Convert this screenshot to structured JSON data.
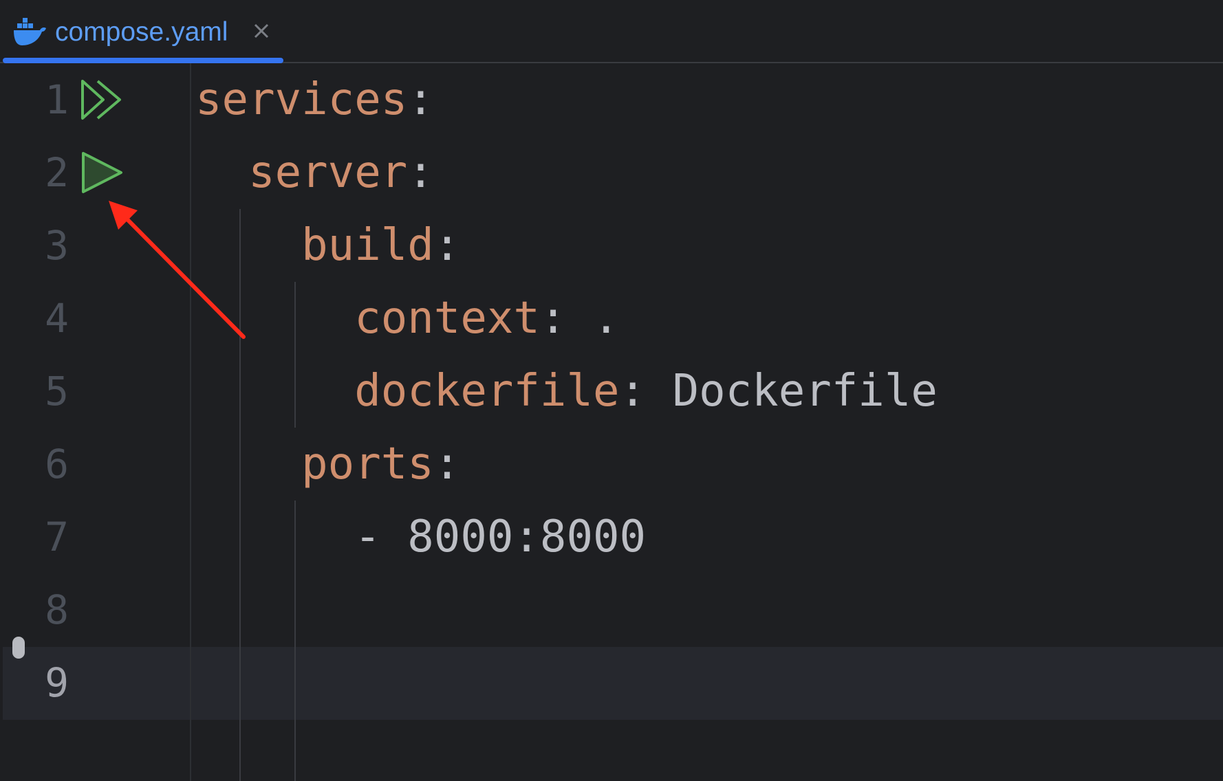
{
  "tab": {
    "label": "compose.yaml",
    "icon": "docker-icon",
    "close_icon": "close-icon",
    "accent_color": "#3574f0",
    "label_color": "#5d9df5"
  },
  "editor": {
    "current_line": 9,
    "lines": [
      {
        "number": "1",
        "key": "services",
        "colon": ":",
        "value": "",
        "gutter_icon": "run-all-icon"
      },
      {
        "number": "2",
        "key": "server",
        "colon": ":",
        "value": "",
        "gutter_icon": "run-icon"
      },
      {
        "number": "3",
        "key": "build",
        "colon": ":",
        "value": ""
      },
      {
        "number": "4",
        "key": "context",
        "colon": ":",
        "value": " ."
      },
      {
        "number": "5",
        "key": "dockerfile",
        "colon": ":",
        "value": " Dockerfile"
      },
      {
        "number": "6",
        "key": "ports",
        "colon": ":",
        "value": ""
      },
      {
        "number": "7",
        "key": "",
        "colon": "",
        "value": "- 8000:8000"
      },
      {
        "number": "8",
        "key": "",
        "colon": "",
        "value": ""
      },
      {
        "number": "9",
        "key": "",
        "colon": "",
        "value": ""
      }
    ],
    "colors": {
      "background": "#1e1f22",
      "key": "#cf8e6d",
      "text": "#bcbec4",
      "line_number": "#4b5059",
      "run_icon": "#5fb85f"
    }
  },
  "annotation": {
    "type": "arrow",
    "color": "#ff2a1a",
    "points_to": "run-service-icon"
  }
}
